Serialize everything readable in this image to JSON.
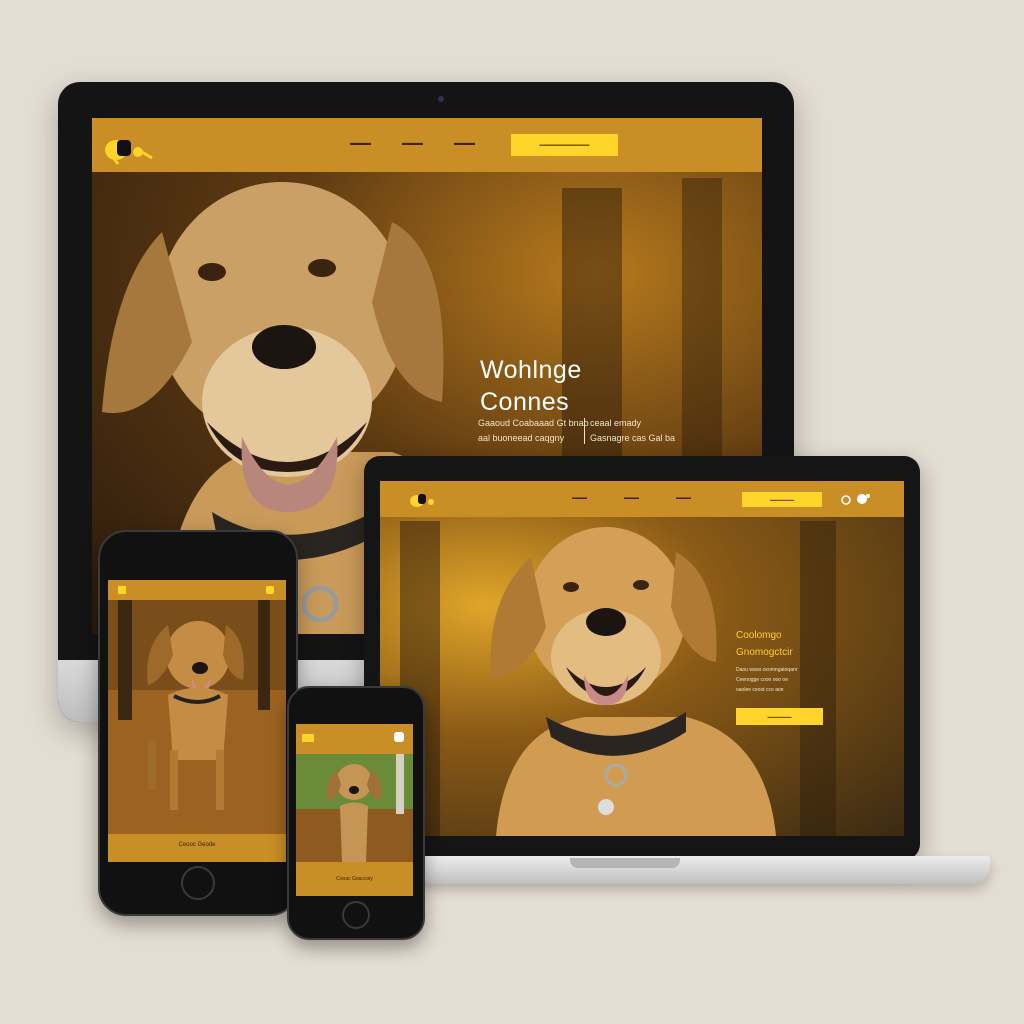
{
  "desktop": {
    "hero_title_line1": "Wohlnge",
    "hero_title_line2": "Connes",
    "sub_left_1": "Gaaoud Coabaaad Gt bnao",
    "sub_left_2": "aal buoneead caqgny",
    "sub_right_1": "ceaal emady",
    "sub_right_2": "Gasnagre cas Gal ba"
  },
  "laptop": {
    "hero_title_line1": "Coolomgo",
    "hero_title_line2": "Gnomogctcir",
    "sub_1": "Daou waoo ceomngatoqanr",
    "sub_2": "Ceenogge coon ooo oe",
    "sub_3": "oaolee ceoot cco aoe"
  },
  "phone_large": {
    "footer_label": "Ceooc Geode"
  },
  "phone_small": {
    "footer_label": "Cooac Goaccoiy"
  },
  "colors": {
    "accent": "#c98e26",
    "cta": "#ffd52c",
    "background": "#e3ddd2"
  }
}
